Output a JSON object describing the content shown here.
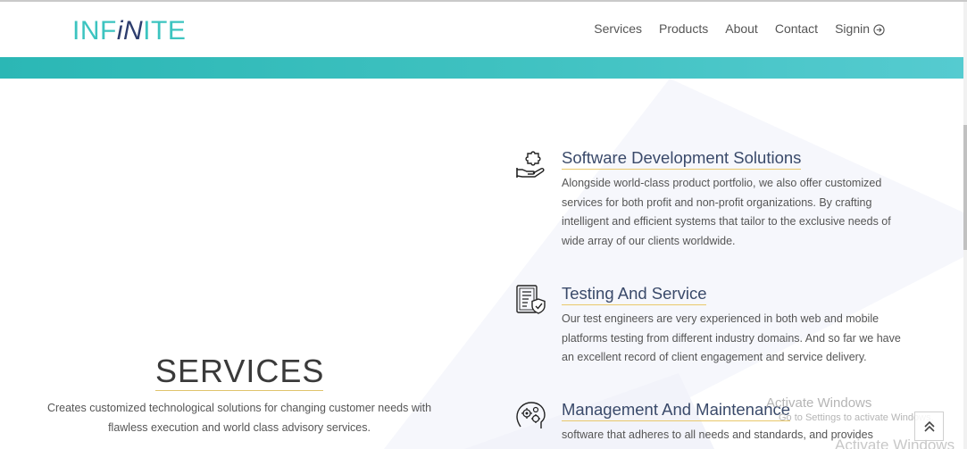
{
  "header": {
    "logo": {
      "part1": "INF",
      "part2": "iN",
      "part3": "ITE"
    },
    "nav": [
      {
        "label": "Services"
      },
      {
        "label": "Products"
      },
      {
        "label": "About"
      },
      {
        "label": "Contact"
      },
      {
        "label": "Signin"
      }
    ]
  },
  "services": {
    "title": "SERVICES",
    "description": "Creates customized technological solutions for changing customer needs with flawless execution and world class advisory services."
  },
  "items": [
    {
      "icon": "puzzle-hand-icon",
      "title": "Software Development Solutions",
      "text": "Alongside world-class product portfolio, we also offer customized services for both profit and non-profit organizations. By crafting intelligent and efficient systems that tailor to the exclusive needs of wide array of our clients worldwide."
    },
    {
      "icon": "document-shield-icon",
      "title": "Testing And Service",
      "text": "Our test engineers are very experienced in both web and mobile platforms testing from different industry domains. And so far we have an excellent record of client engagement and service delivery."
    },
    {
      "icon": "head-gears-icon",
      "title": "Management And Maintenance",
      "text": "software that adheres to all needs and standards, and provides"
    }
  ],
  "watermark": {
    "title": "Activate Windows",
    "subtitle": "Go to Settings to activate Windows.",
    "ghost": "Activate Windows"
  },
  "colors": {
    "teal": "#3ec1c0",
    "navy": "#2e3e6e",
    "gold_underline": "#e9c86a"
  }
}
